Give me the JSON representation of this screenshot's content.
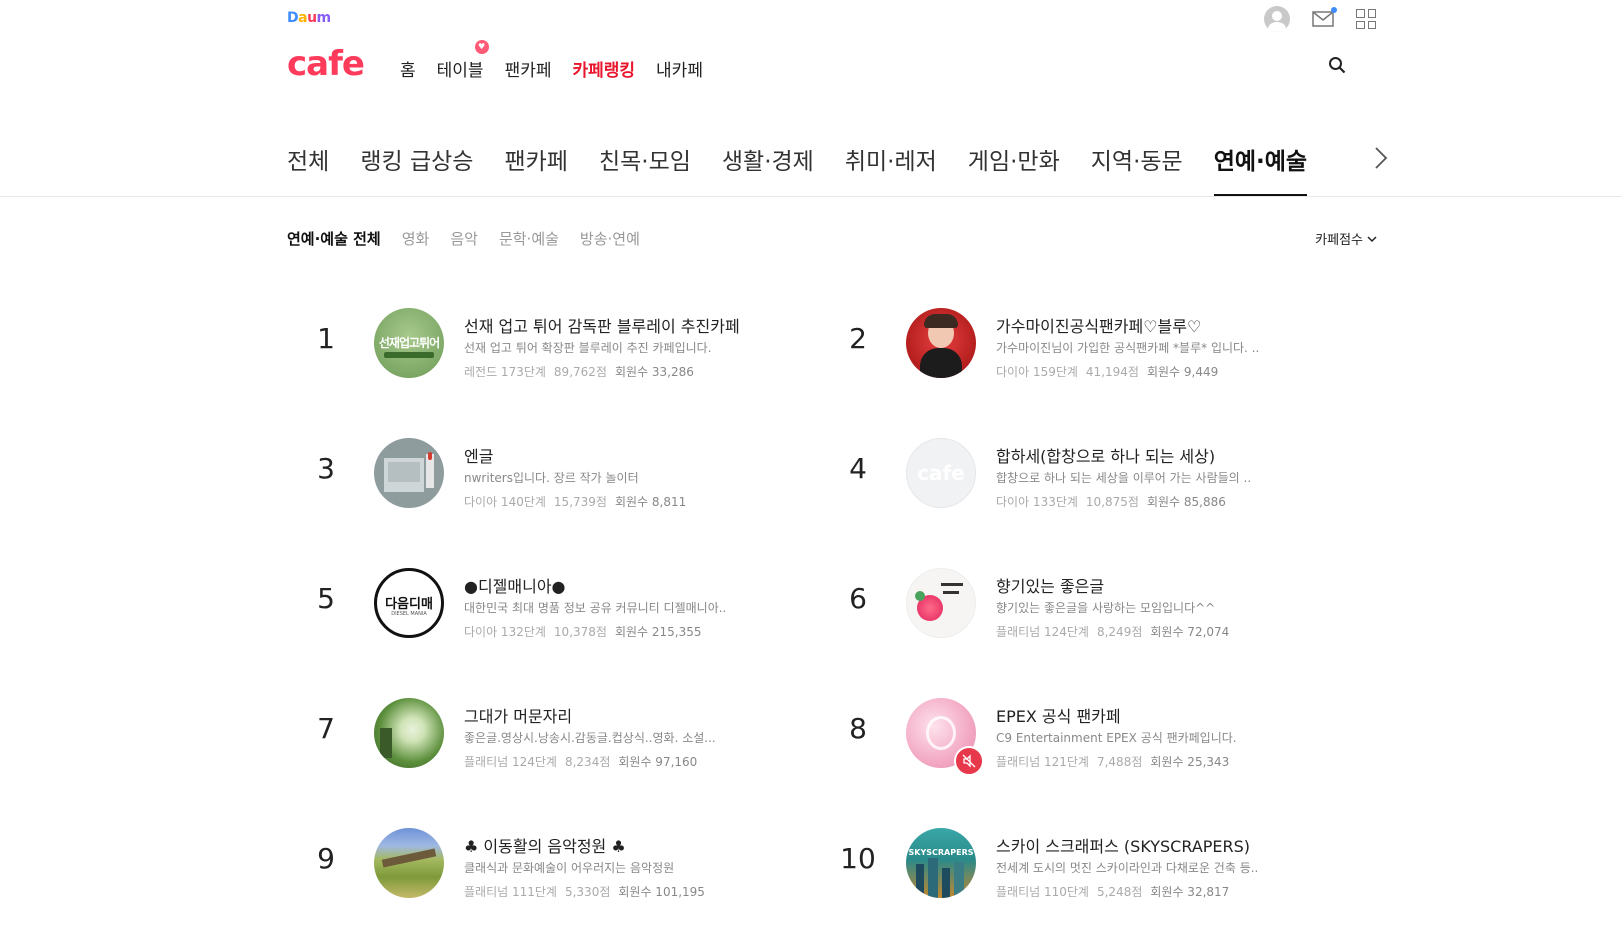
{
  "header": {
    "daum_logo": "Daum",
    "cafe_logo": "cafe",
    "nav": [
      {
        "label": "홈",
        "active": false
      },
      {
        "label": "테이블",
        "active": false
      },
      {
        "label": "팬카페",
        "active": false
      },
      {
        "label": "카페랭킹",
        "active": true
      },
      {
        "label": "내카페",
        "active": false
      }
    ]
  },
  "categories": [
    {
      "label": "전체",
      "active": false
    },
    {
      "label": "랭킹 급상승",
      "active": false
    },
    {
      "label": "팬카페",
      "active": false
    },
    {
      "label": "친목·모임",
      "active": false
    },
    {
      "label": "생활·경제",
      "active": false
    },
    {
      "label": "취미·레저",
      "active": false
    },
    {
      "label": "게임·만화",
      "active": false
    },
    {
      "label": "지역·동문",
      "active": false
    },
    {
      "label": "연예·예술",
      "active": true
    }
  ],
  "sub_categories": [
    {
      "label": "연예·예술 전체",
      "active": true
    },
    {
      "label": "영화",
      "active": false
    },
    {
      "label": "음악",
      "active": false
    },
    {
      "label": "문학·예술",
      "active": false
    },
    {
      "label": "방송·연예",
      "active": false
    }
  ],
  "sort_label": "카페점수",
  "ranking": [
    {
      "rank": "1",
      "title": "선재 업고 튀어 감독판 블루레이 추진카페",
      "desc": "선재 업고 튀어 확장판 블루레이 추진 카페입니다.",
      "level": "레전드 173단계",
      "score": "89,762점",
      "members": "회원수 33,286",
      "thumb_color": "#7fb46a"
    },
    {
      "rank": "2",
      "title": "가수마이진공식팬카페♡블루♡",
      "desc": "가수마이진님이 가입한 공식팬카페 *블루* 입니다. ..",
      "level": "다이아 159단계",
      "score": "41,194점",
      "members": "회원수 9,449",
      "thumb_color": "#d42020"
    },
    {
      "rank": "3",
      "title": "엔글",
      "desc": "nwriters입니다. 장르 작가 놀이터",
      "level": "다이아 140단계",
      "score": "15,739점",
      "members": "회원수 8,811",
      "thumb_color": "#8d9a9c"
    },
    {
      "rank": "4",
      "title": "합하세(합창으로 하나 되는 세상)",
      "desc": "합창으로 하나 되는 세상을 이루어 가는 사람들의 ..",
      "level": "다이아 133단계",
      "score": "10,875점",
      "members": "회원수 85,886",
      "thumb_color": "#f1f2f4"
    },
    {
      "rank": "5",
      "title": "●디젤매니아●",
      "desc": "대한민국 최대 명품 정보 공유 커뮤니티 디젤매니아..",
      "level": "다이아 132단계",
      "score": "10,378점",
      "members": "회원수 215,355",
      "thumb_color": "#ffffff"
    },
    {
      "rank": "6",
      "title": "향기있는 좋은글",
      "desc": "향기있는 좋은글을 사랑하는 모임입니다^^",
      "level": "플래티넘 124단계",
      "score": "8,249점",
      "members": "회원수 72,074",
      "thumb_color": "#f6f4f2"
    },
    {
      "rank": "7",
      "title": "그대가 머문자리",
      "desc": "좋은글.영상시.낭송시.감동글.컵상식..영화. 소설...",
      "level": "플래티넘 124단계",
      "score": "8,234점",
      "members": "회원수 97,160",
      "thumb_color": "#5c8f3c"
    },
    {
      "rank": "8",
      "title": "EPEX 공식 팬카페",
      "desc": "C9 Entertainment EPEX 공식 팬카페입니다.",
      "level": "플래티넘 121단계",
      "score": "7,488점",
      "members": "회원수 25,343",
      "thumb_color": "#f3b3c8"
    },
    {
      "rank": "9",
      "title": "♣ 이동활의 음악정원 ♣",
      "desc": "클래식과 문화예술이 어우러지는 음악정원",
      "level": "플래티넘 111단계",
      "score": "5,330점",
      "members": "회원수 101,195",
      "thumb_color": "#8aa64a"
    },
    {
      "rank": "10",
      "title": "스카이 스크래퍼스 (SKYSCRAPERS)",
      "desc": "전세계 도시의 멋진 스카이라인과 다채로운 건축 등..",
      "level": "플래티넘 110단계",
      "score": "5,248점",
      "members": "회원수 32,817",
      "thumb_color": "#2a8a8a"
    }
  ],
  "thumb_texts": {
    "item1": "선재업고튀어",
    "item4": "cafe",
    "item5": "다음디매",
    "item5_sub": "DIESEL MANIA",
    "item10": "SKYSCRAPERS"
  },
  "colors": {
    "accent": "#e8152c",
    "logo": "#ff3b5c"
  }
}
